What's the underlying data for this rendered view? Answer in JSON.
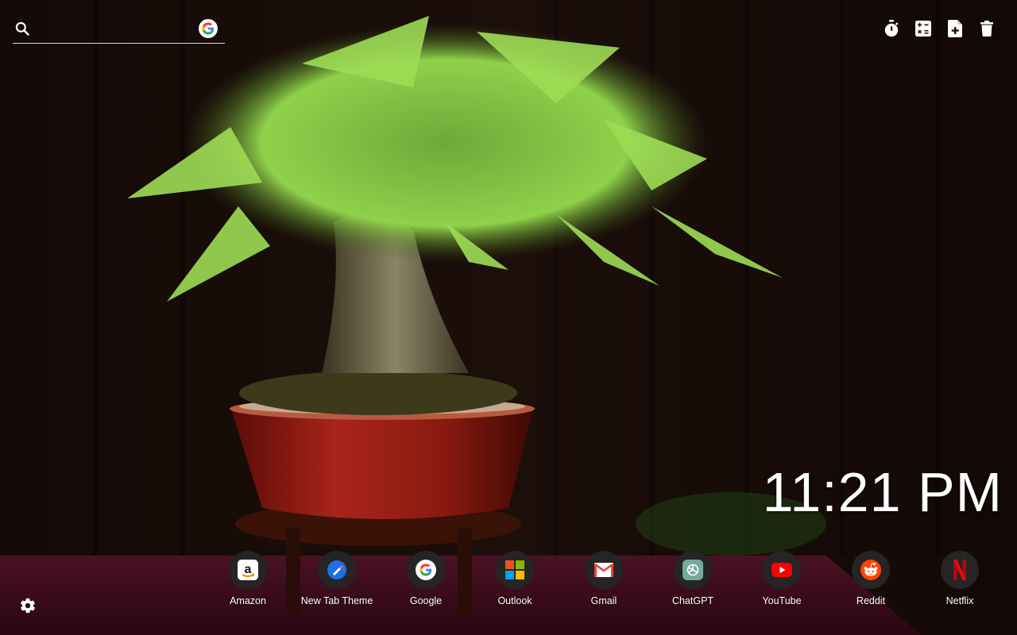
{
  "search": {
    "value": "",
    "placeholder": "",
    "engine_icon": "google-g-icon"
  },
  "toolbar": {
    "items": [
      {
        "icon": "stopwatch-icon"
      },
      {
        "icon": "calculator-icon"
      },
      {
        "icon": "new-note-icon"
      },
      {
        "icon": "trash-icon"
      }
    ]
  },
  "clock": {
    "time": "11:21 PM"
  },
  "shortcuts": [
    {
      "label": "Amazon",
      "icon": "amazon-icon"
    },
    {
      "label": "New Tab Theme",
      "icon": "new-tab-theme-icon"
    },
    {
      "label": "Google",
      "icon": "google-icon"
    },
    {
      "label": "Outlook",
      "icon": "outlook-icon"
    },
    {
      "label": "Gmail",
      "icon": "gmail-icon"
    },
    {
      "label": "ChatGPT",
      "icon": "chatgpt-icon"
    },
    {
      "label": "YouTube",
      "icon": "youtube-icon"
    },
    {
      "label": "Reddit",
      "icon": "reddit-icon"
    },
    {
      "label": "Netflix",
      "icon": "netflix-icon"
    }
  ],
  "settings": {
    "icon": "gear-icon"
  },
  "colors": {
    "icon_bg": "#262424",
    "text": "#ffffff",
    "pot": "#9a1d12",
    "leaf": "#8fd14a",
    "table": "#3a0c1c"
  }
}
